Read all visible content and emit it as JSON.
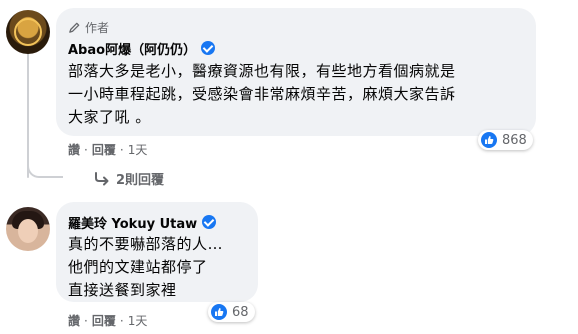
{
  "comment1": {
    "badge_label": "作者",
    "author_name": "Abao阿爆（阿仍仍）",
    "text": "部落大多是老小，醫療資源也有限，有些地方看個病就是\n一小時車程起跳，受感染會非常麻煩辛苦，麻煩大家告訴\n大家了吼 。",
    "reaction_count": "868",
    "actions": {
      "like": "讚",
      "sep1": "·",
      "reply": "回覆",
      "sep2": "·",
      "time": "1天"
    },
    "replies_label": "2則回覆"
  },
  "comment2": {
    "author_name": "羅美玲 Yokuy Utaw",
    "text": "真的不要嚇部落的人…\n他們的文建站都停了\n直接送餐到家裡",
    "reaction_count": "68",
    "actions": {
      "like": "讚",
      "sep1": "·",
      "reply": "回覆",
      "sep2": "·",
      "time": "1天"
    }
  },
  "colors": {
    "bubble": "#f0f2f5",
    "accent": "#1877f2",
    "muted": "#65676b"
  }
}
